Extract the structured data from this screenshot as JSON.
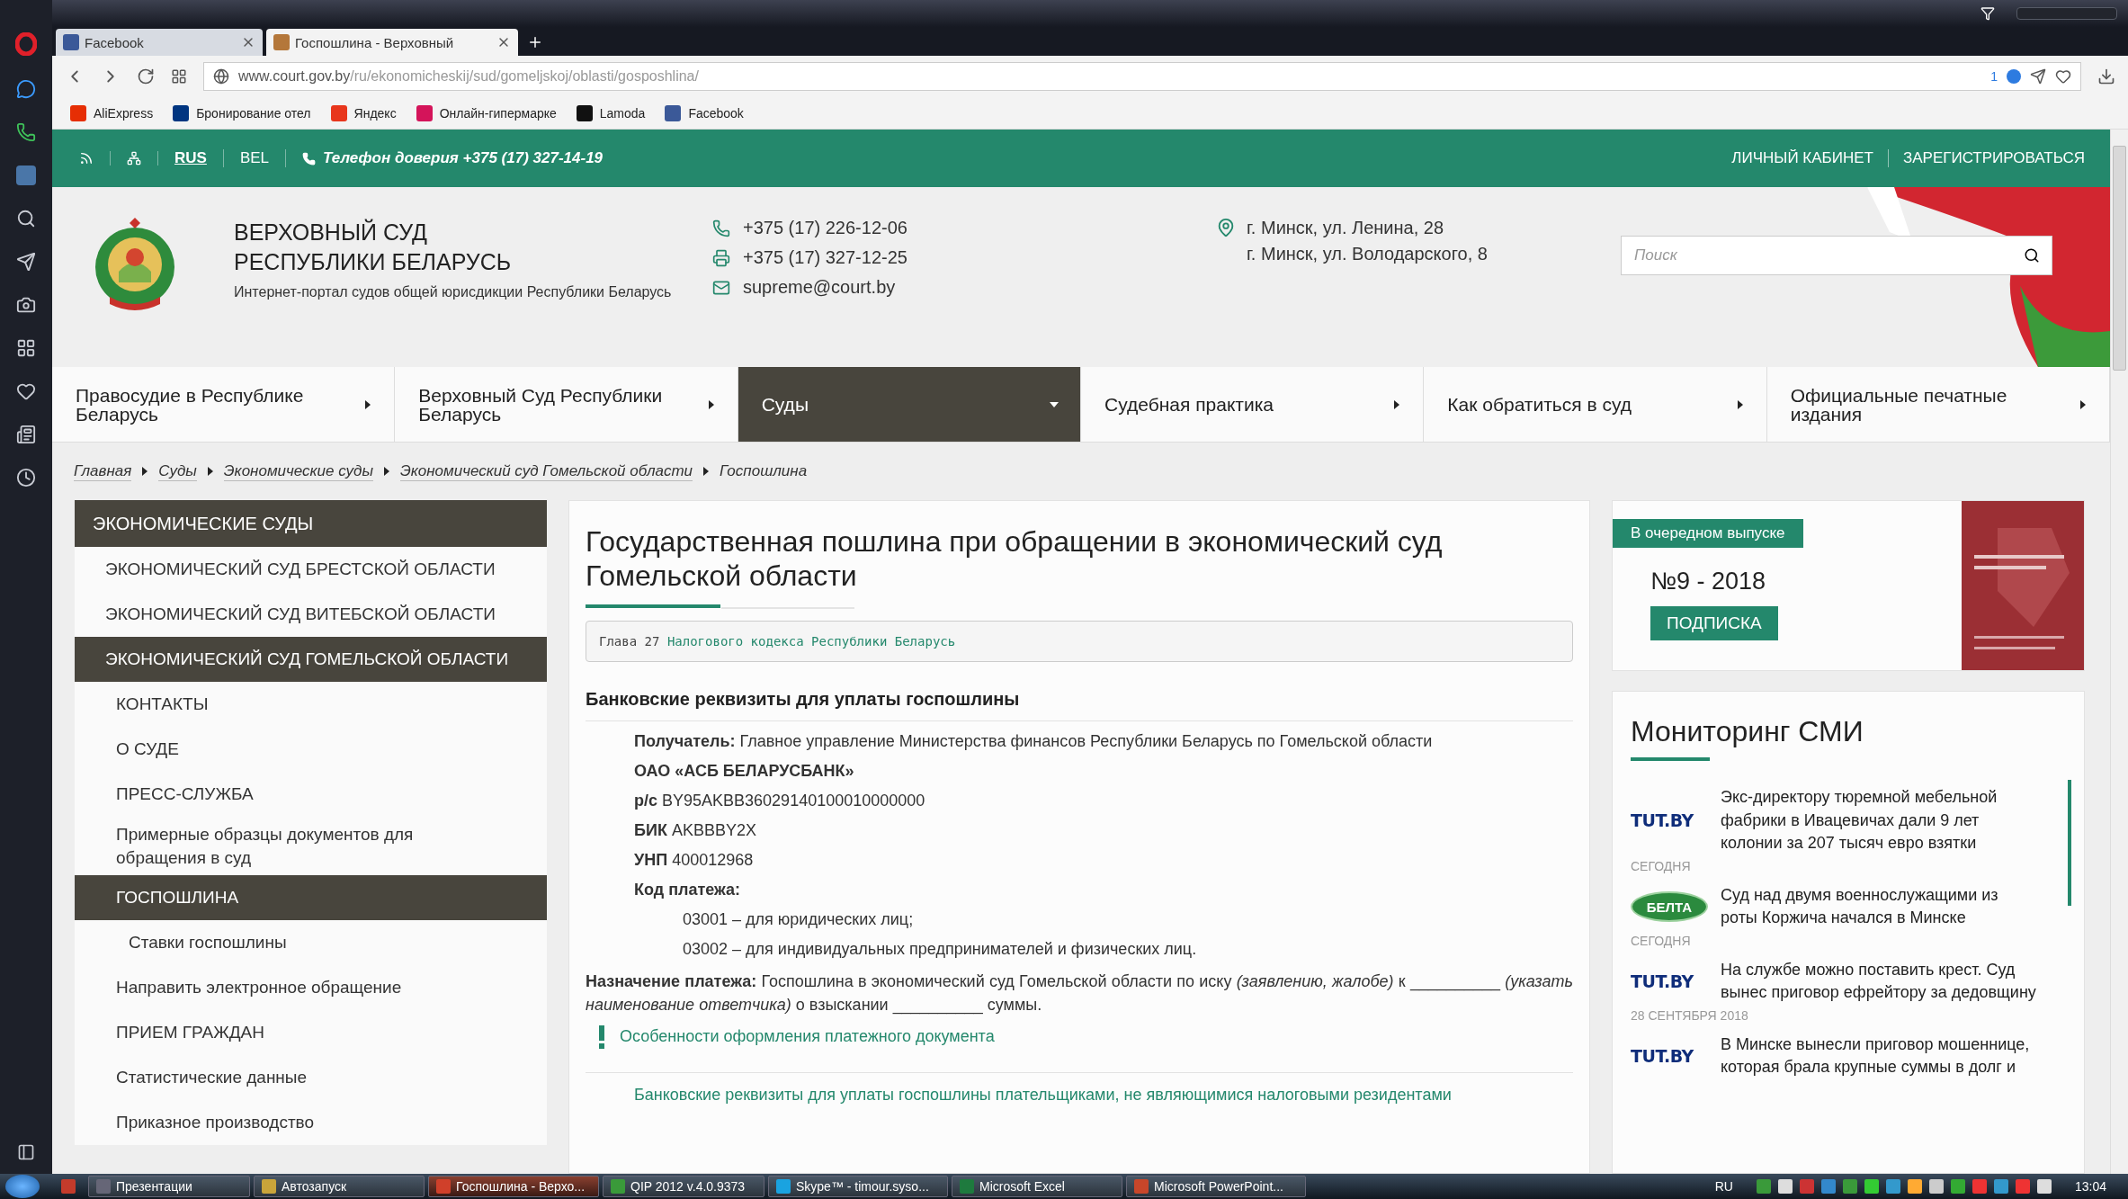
{
  "browser": {
    "tabs": [
      {
        "label": "Facebook",
        "selected": false
      },
      {
        "label": "Госпошлина - Верховный",
        "selected": true
      }
    ],
    "address": {
      "host": "www.court.gov.by",
      "path": "/ru/ekonomicheskij/sud/gomeljskoj/oblasti/gosposhlina/",
      "blocked_count": "1"
    },
    "bookmarks": [
      "AliExpress",
      "Бронирование отел",
      "Яндекс",
      "Онлайн-гипермарке",
      "Lamoda",
      "Facebook"
    ]
  },
  "top_bar": {
    "languages": [
      {
        "label": "RUS",
        "selected": true
      },
      {
        "label": "BEL",
        "selected": false
      }
    ],
    "hotline": "Телефон доверия +375 (17) 327-14-19",
    "account_links": [
      "ЛИЧНЫЙ КАБИНЕТ",
      "ЗАРЕГИСТРИРОВАТЬСЯ"
    ]
  },
  "header": {
    "title_lines": [
      "ВЕРХОВНЫЙ СУД",
      "РЕСПУБЛИКИ БЕЛАРУСЬ"
    ],
    "subtitle": "Интернет-портал судов общей юрисдикции Республики Беларусь",
    "contacts": [
      {
        "kind": "phone",
        "text": "+375 (17) 226-12-06"
      },
      {
        "kind": "fax",
        "text": "+375 (17) 327-12-25"
      },
      {
        "kind": "email",
        "text": "supreme@court.by"
      }
    ],
    "addresses": [
      "г. Минск, ул. Ленина, 28",
      "г. Минск, ул. Володарского, 8"
    ],
    "search": {
      "placeholder": "Поиск"
    }
  },
  "nav": [
    {
      "label": "Правосудие в Республике Беларусь",
      "selected": false
    },
    {
      "label": "Верховный Суд Республики Беларусь",
      "selected": false
    },
    {
      "label": "Суды",
      "selected": true
    },
    {
      "label": "Судебная практика",
      "selected": false
    },
    {
      "label": "Как обратиться в суд",
      "selected": false
    },
    {
      "label": "Официальные печатные издания",
      "selected": false
    }
  ],
  "breadcrumbs": [
    "Главная",
    "Суды",
    "Экономические суды",
    "Экономический суд Гомельской области",
    "Госпошлина"
  ],
  "sidebar": {
    "title": "ЭКОНОМИЧЕСКИЕ СУДЫ",
    "items": [
      {
        "label": "ЭКОНОМИЧЕСКИЙ СУД БРЕСТСКОЙ ОБЛАСТИ",
        "selected": false
      },
      {
        "label": "ЭКОНОМИЧЕСКИЙ СУД ВИТЕБСКОЙ ОБЛАСТИ",
        "selected": false
      },
      {
        "label": "ЭКОНОМИЧЕСКИЙ СУД ГОМЕЛЬСКОЙ ОБЛАСТИ",
        "selected": true,
        "children": [
          {
            "label": "КОНТАКТЫ",
            "selected": false
          },
          {
            "label": "О СУДЕ",
            "selected": false
          },
          {
            "label": "ПРЕСС-СЛУЖБА",
            "selected": false
          },
          {
            "label": "Примерные образцы документов для обращения в суд",
            "selected": false
          },
          {
            "label": "ГОСПОШЛИНА",
            "selected": true,
            "children": [
              {
                "label": "Ставки госпошлины",
                "selected": false
              }
            ]
          },
          {
            "label": "Направить электронное обращение",
            "selected": false
          },
          {
            "label": "ПРИЕМ ГРАЖДАН",
            "selected": false
          },
          {
            "label": "Статистические данные",
            "selected": false
          },
          {
            "label": "Приказное производство",
            "selected": false
          }
        ]
      }
    ]
  },
  "article": {
    "title": "Государственная пошлина при обращении в экономический суд Гомельской области",
    "source_note": {
      "text": "Глава 27",
      "link": "Налогового кодекса Республики Беларусь"
    },
    "section_title": "Банковские реквизиты для уплаты госпошлины",
    "details": [
      {
        "label": "Получатель:",
        "value": "Главное управление Министерства финансов Республики Беларусь по Гомельской области"
      },
      {
        "label": "ОАО «АСБ БЕЛАРУСБАНК»"
      },
      {
        "label": "р/с",
        "value": "BY95AKBB36029140100010000000"
      },
      {
        "label": "БИК",
        "value": "AKBBBY2X"
      },
      {
        "label": "УНП",
        "value": "400012968"
      },
      {
        "label": "Код платежа:"
      }
    ],
    "payment_codes": [
      "03001 – для юридических лиц;",
      "03002 – для индивидуальных предпринимателей и физических лиц."
    ],
    "purpose": "**Назначение платежа:** Госпошлина в экономический суд Гомельской области по иску *(заявлению, жалобе)* к __________ *(указать наименование ответчика)* о взыскании __________ суммы.",
    "note_link": "Особенности оформления платежного документа",
    "next_link": "Банковские реквизиты для уплаты госпошлины плательщиками, не являющимися налоговыми резидентами"
  },
  "issue": {
    "badge": "В очередном выпуске",
    "number": "№9 - 2018",
    "button": "ПОДПИСКА"
  },
  "monitoring": {
    "title": "Мониторинг СМИ",
    "news": [
      {
        "source": "TUT.BY",
        "kind": "tutby",
        "text": "Экс-директору тюремной мебельной фабрики в Ивацевичах дали 9 лет колонии за 207 тысяч евро взятки",
        "date": "СЕГОДНЯ"
      },
      {
        "source": "БЕЛТА",
        "kind": "belta",
        "text": "Суд над двумя военнослужащими из роты Коржича начался в Минске",
        "date": "СЕГОДНЯ"
      },
      {
        "source": "TUT.BY",
        "kind": "tutby",
        "text": "На службе можно поставить крест. Суд вынес приговор ефрейтору за дедовщину",
        "date": "28 СЕНТЯБРЯ 2018"
      },
      {
        "source": "TUT.BY",
        "kind": "tutby",
        "text": "В Минске вынесли приговор мошеннице, которая брала крупные суммы в долг и"
      }
    ]
  },
  "taskbar": {
    "items": [
      {
        "label": "Презентации",
        "selected": false
      },
      {
        "label": "Автозапуск",
        "selected": false
      },
      {
        "label": "Госпошлина - Верхо...",
        "selected": true
      },
      {
        "label": "QIP 2012   v.4.0.9373",
        "selected": false
      },
      {
        "label": "Skype™ - timour.syso...",
        "selected": false
      },
      {
        "label": "Microsoft Excel",
        "selected": false
      },
      {
        "label": "Microsoft PowerPoint...",
        "selected": false
      }
    ],
    "language": "RU",
    "clock": "13:04"
  }
}
